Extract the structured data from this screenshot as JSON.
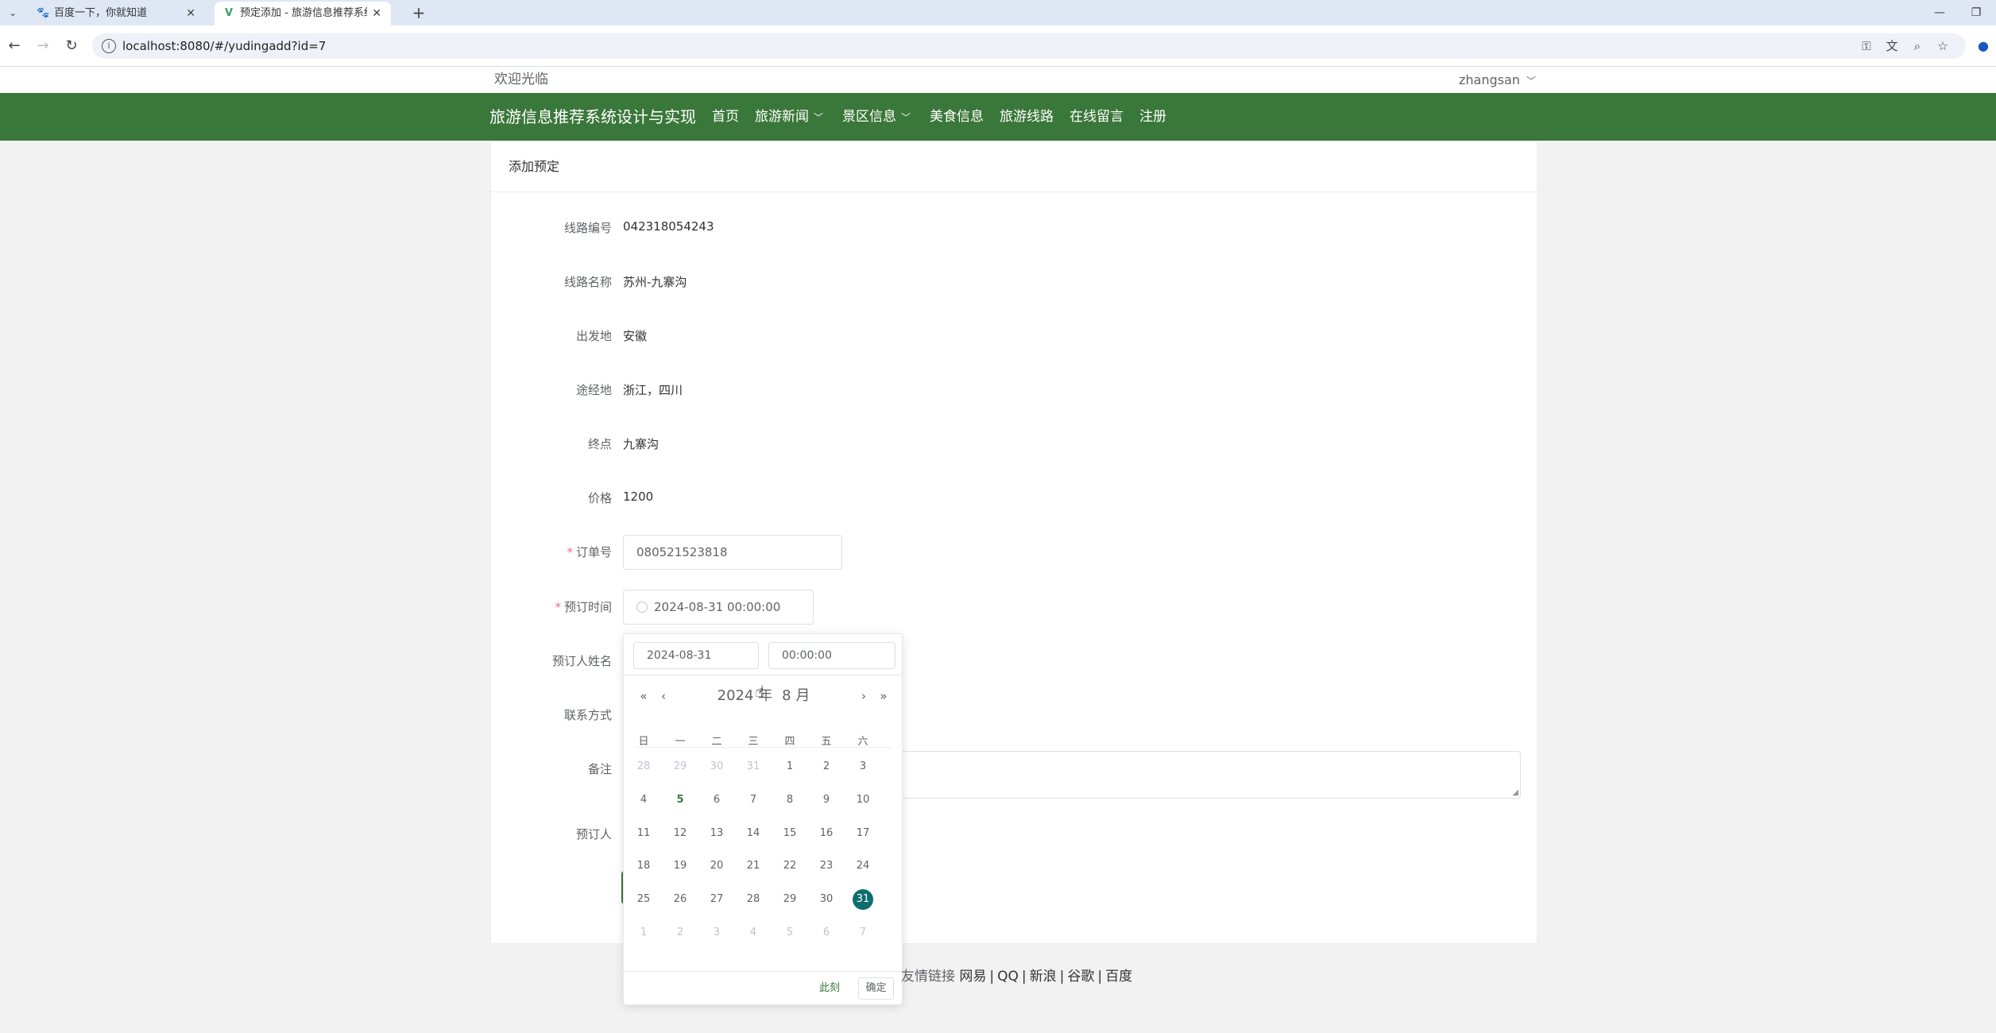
{
  "browser": {
    "tabs": [
      {
        "title": "百度一下，你就知道",
        "close": "✕"
      },
      {
        "title": "预定添加 - 旅游信息推荐系统设计与实现",
        "close": "✕"
      }
    ],
    "new_tab": "+",
    "url": "localhost:8080/#/yudingadd?id=7",
    "window_controls": {
      "minimize": "—",
      "restore": "❐"
    }
  },
  "header": {
    "welcome": "欢迎光临",
    "username": "zhangsan",
    "brand": "旅游信息推荐系统设计与实现",
    "nav": [
      "首页",
      "旅游新闻",
      "景区信息",
      "美食信息",
      "旅游线路",
      "在线留言",
      "注册"
    ]
  },
  "card": {
    "title": "添加预定",
    "fields": [
      {
        "label": "线路编号",
        "value": "042318054243"
      },
      {
        "label": "线路名称",
        "value": "苏州-九寨沟"
      },
      {
        "label": "出发地",
        "value": "安徽"
      },
      {
        "label": "途经地",
        "value": "浙江，四川"
      },
      {
        "label": "终点",
        "value": "九寨沟"
      },
      {
        "label": "价格",
        "value": "1200"
      }
    ],
    "order_no": {
      "label": "订单号",
      "required_mark": "*",
      "value": "080521523818"
    },
    "book_time": {
      "label": "预订时间",
      "required_mark": "*",
      "value": "2024-08-31 00:00:00"
    },
    "booker_name_label": "预订人姓名",
    "contact_label": "联系方式",
    "remark_label": "备注",
    "booker_label": "预订人"
  },
  "datepicker": {
    "date_input": "2024-08-31",
    "time_input": "00:00:00",
    "year_label": "2024 年",
    "month_label": "8 月",
    "prev_year": "«",
    "prev_month": "‹",
    "next_month": "›",
    "next_year": "»",
    "weekdays": [
      "日",
      "一",
      "二",
      "三",
      "四",
      "五",
      "六"
    ],
    "weeks": [
      [
        "28",
        "29",
        "30",
        "31",
        "1",
        "2",
        "3"
      ],
      [
        "4",
        "5",
        "6",
        "7",
        "8",
        "9",
        "10"
      ],
      [
        "11",
        "12",
        "13",
        "14",
        "15",
        "16",
        "17"
      ],
      [
        "18",
        "19",
        "20",
        "21",
        "22",
        "23",
        "24"
      ],
      [
        "25",
        "26",
        "27",
        "28",
        "29",
        "30",
        "31"
      ],
      [
        "1",
        "2",
        "3",
        "4",
        "5",
        "6",
        "7"
      ]
    ],
    "today": "5",
    "selected": "31",
    "now_button": "此刻",
    "confirm_button": "确定"
  },
  "footer": {
    "label": "友情链接",
    "links": [
      "网易",
      "QQ",
      "新浪",
      "谷歌",
      "百度"
    ],
    "separator": "|"
  },
  "colors": {
    "brand_green": "#3a773a",
    "selected_day": "#0e6e6e",
    "required": "#f56c6c"
  }
}
